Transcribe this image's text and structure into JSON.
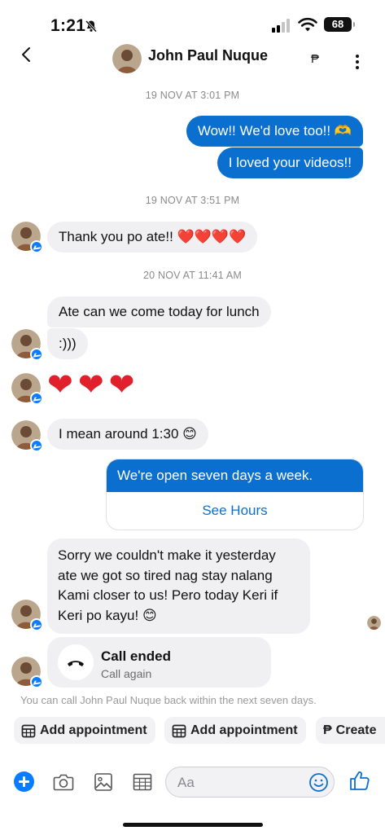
{
  "status_bar": {
    "time": "1:21",
    "battery": "68"
  },
  "header": {
    "contact_name": "John Paul Nuque",
    "peso_label": "₱"
  },
  "colors": {
    "accent": "#0b6fd0",
    "incoming_bubble": "#f0f0f2",
    "badge": "#0a7cff"
  },
  "timestamps": [
    "19 NOV AT 3:01 PM",
    "19 NOV AT 3:51 PM",
    "20 NOV AT 11:41 AM"
  ],
  "messages": {
    "out1": "Wow!! We'd love too!! 🫶",
    "out2": "I loved your videos!!",
    "in1": "Thank you po ate!! ❤️❤️❤️❤️",
    "in2": "Ate can we come today for lunch",
    "in3": ":)))",
    "in4": "❤❤❤",
    "in5": "I mean around 1:30 😊",
    "hours_card": {
      "text": "We're open seven days a week.",
      "button": "See Hours"
    },
    "in6": "Sorry we couldn't make it yesterday\nate we got so tired nag stay nalang\nKami closer to us! Pero today Keri if\nKeri po kayu! 😊"
  },
  "call": {
    "title": "Call ended",
    "subtitle": "Call again",
    "note": "You can call John Paul Nuque back within the next seven days."
  },
  "quick_actions": [
    "Add appointment",
    "Add appointment",
    "Create"
  ],
  "composer": {
    "placeholder": "Aa"
  },
  "icons": [
    "back-icon",
    "more-icon",
    "bell-slash-icon",
    "wifi-icon",
    "plus-icon",
    "camera-icon",
    "image-icon",
    "calendar-icon",
    "emoji-icon",
    "like-icon",
    "phone-hangup-icon"
  ]
}
